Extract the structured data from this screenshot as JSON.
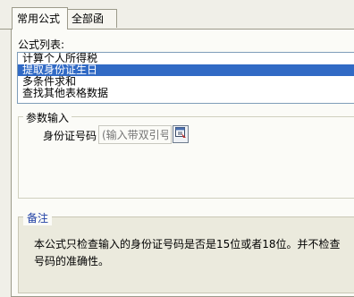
{
  "tabs": [
    {
      "label": "常用公式",
      "active": true
    },
    {
      "label": "全部函数",
      "active": false
    }
  ],
  "formula_list": {
    "label": "公式列表:",
    "items": [
      {
        "label": "计算个人所得税",
        "selected": false
      },
      {
        "label": "提取身份证生日",
        "selected": true
      },
      {
        "label": "多条件求和",
        "selected": false
      },
      {
        "label": "查找其他表格数据",
        "selected": false
      }
    ]
  },
  "params": {
    "title": "参数输入",
    "field_label": "身份证号码",
    "field_placeholder": "(输入带双引号"
  },
  "note": {
    "title": "备注",
    "text": "本公式只检查输入的身份证号码是否是15位或者18位。并不检查号码的准确性。"
  },
  "colors": {
    "selection": "#316ac5",
    "note_title": "#1f3fa4",
    "panel_bg": "#fbfbf7"
  }
}
